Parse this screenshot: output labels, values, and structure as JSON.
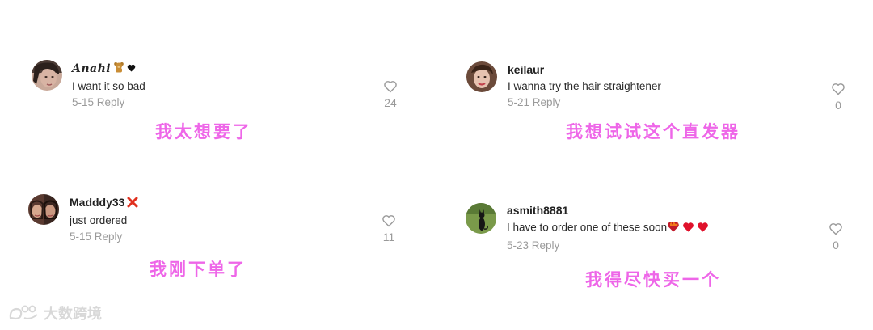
{
  "comments": [
    {
      "username": "Anahi",
      "text": "I want it so bad",
      "date": "5-15",
      "reply_label": "Reply",
      "likes": "24",
      "translation": "我太想要了",
      "username_emoji": [
        "teddy-bear-emoji",
        "black-heart-emoji"
      ]
    },
    {
      "username": "keilaur",
      "text": "I wanna try the hair straightener",
      "date": "5-21",
      "reply_label": "Reply",
      "likes": "0",
      "translation": "我想试试这个直发器"
    },
    {
      "username": "Madddy33",
      "text": "just ordered",
      "date": "5-15",
      "reply_label": "Reply",
      "likes": "11",
      "translation": "我刚下单了",
      "username_emoji": [
        "red-cross-mark-emoji"
      ]
    },
    {
      "username": "asmith8881",
      "text": "I have to order one of these soon",
      "date": "5-23",
      "reply_label": "Reply",
      "likes": "0",
      "translation": "我得尽快买一个",
      "text_emoji": [
        "heart-on-fire-emoji",
        "red-heart-emoji",
        "red-heart-emoji"
      ]
    }
  ],
  "watermark": {
    "text": "大数跨境",
    "icon": "logo-icon"
  },
  "colors": {
    "translation": "#ee66e8",
    "meta": "#9a9a9a",
    "heart_outline": "#9a9a9a",
    "red_heart": "#e0112b"
  }
}
